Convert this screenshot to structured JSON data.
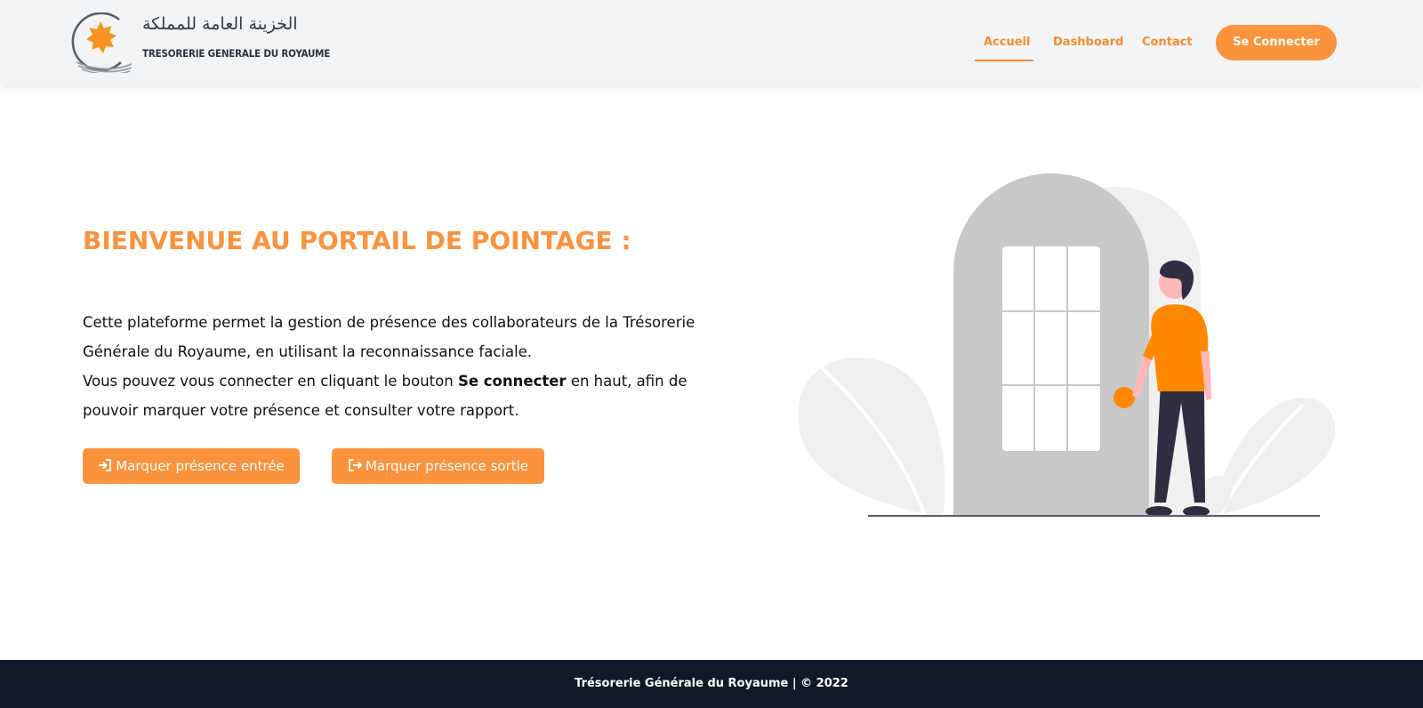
{
  "header": {
    "logo": {
      "arabic_text": "الخزينة العامة للمملكة",
      "french_text": "TRESORERIE GENERALE DU ROYAUME"
    },
    "nav": [
      {
        "label": "Accueil",
        "active": true
      },
      {
        "label": "Dashboard",
        "active": false
      },
      {
        "label": "Contact",
        "active": false
      }
    ],
    "login_button": "Se Connecter"
  },
  "hero": {
    "title": "BIENVENUE AU PORTAIL DE POINTAGE :",
    "paragraph1": "Cette plateforme permet la gestion de présence des collaborateurs de la Trésorerie Générale du Royaume, en utilisant la reconnaissance faciale.",
    "paragraph2_before": "Vous pouvez vous connecter en cliquant le bouton ",
    "paragraph2_bold": "Se connecter",
    "paragraph2_after": " en haut, afin de pouvoir marquer votre présence et consulter votre rapport.",
    "buttons": [
      {
        "label": "Marquer présence entrée",
        "icon": "sign-in-icon"
      },
      {
        "label": "Marquer présence sortie",
        "icon": "sign-out-icon"
      }
    ]
  },
  "footer": {
    "text": "Trésorerie Générale du Royaume | © 2022"
  },
  "colors": {
    "accent": "#fb923c",
    "nav_text": "#f28c2c",
    "header_bg": "#f3f4f6",
    "footer_bg": "#111827",
    "door": "#c8c8c8",
    "plant": "#f0f0f0",
    "pants": "#2f2e41"
  }
}
